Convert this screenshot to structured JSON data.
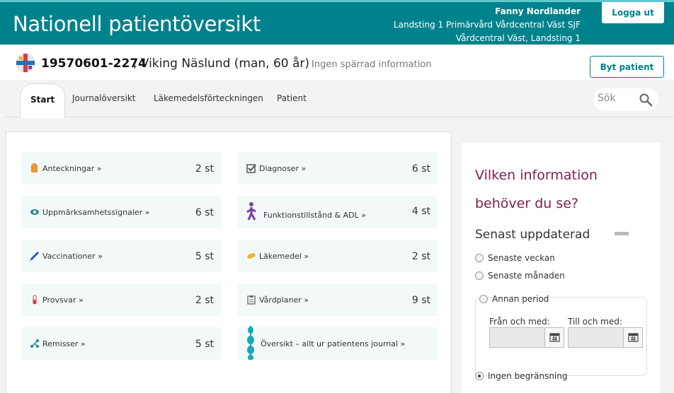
{
  "header": {
    "app_title": "Nationell patientöversikt",
    "user_name": "Fanny Nordlander",
    "user_org": "Landsting 1 Primärvård Vårdcentral Väst SJF",
    "user_unit": "Vårdcentral Väst, Landsting 1",
    "logout_label": "Logga ut"
  },
  "patient": {
    "id": "19570601-2274",
    "name": ", Viking Näslund (man, 60 år)",
    "lock_status": "Ingen spärrad information",
    "switch_label": "Byt patient"
  },
  "tabs": [
    "Start",
    "Journalöversikt",
    "Läkemedelsförteckningen",
    "Patient"
  ],
  "search": {
    "placeholder": "Sök"
  },
  "tiles": [
    {
      "label": "Anteckningar »",
      "count": "2 st",
      "icon": "notes-icon",
      "color": "#f0942e"
    },
    {
      "label": "Diagnoser »",
      "count": "6 st",
      "icon": "diagnosis-check-icon",
      "color": "#555555"
    },
    {
      "label": "Uppmärksamhetssignaler »",
      "count": "6 st",
      "icon": "eye-icon",
      "color": "#2a8c8c"
    },
    {
      "label": "Funktionstillstånd & ADL »",
      "count": "4 st",
      "icon": "walking-person-icon",
      "color": "#7b3fa0"
    },
    {
      "label": "Vaccinationer »",
      "count": "5 st",
      "icon": "syringe-icon",
      "color": "#3a4fb0"
    },
    {
      "label": "Läkemedel »",
      "count": "2 st",
      "icon": "pill-icon",
      "color": "#f0b43c"
    },
    {
      "label": "Provsvar »",
      "count": "2 st",
      "icon": "test-tube-icon",
      "color": "#d8394a"
    },
    {
      "label": "Vårdplaner »",
      "count": "9 st",
      "icon": "clipboard-icon",
      "color": "#666666"
    },
    {
      "label": "Remisser »",
      "count": "5 st",
      "icon": "referral-icon",
      "color": "#1f8c8c"
    },
    {
      "label": "Översikt – allt ur patientens journal »",
      "count": "",
      "icon": "timeline-icon",
      "color": "#12aab8"
    }
  ],
  "sidepanel": {
    "title": "Vilken information behöver du se?",
    "subtitle": "Senast uppdaterad",
    "options": [
      "Senaste veckan",
      "Senaste månaden",
      "Annan period",
      "Ingen begränsning"
    ],
    "selected": "Ingen begränsning",
    "from_label": "Från och med:",
    "to_label": "Till och med:"
  },
  "colors": {
    "primary": "#00828c",
    "accent": "#7e1e4d",
    "tile_bg": "#f3f9f9"
  }
}
